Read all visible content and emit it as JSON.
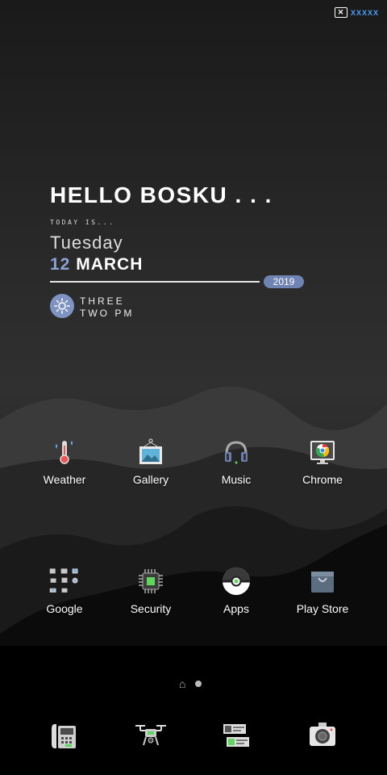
{
  "ad": {
    "label": "XXXXX",
    "close_glyph": "✕"
  },
  "widget": {
    "greeting": "HELLO BOSKU . . .",
    "today_is": "TODAY IS...",
    "weekday": "Tuesday",
    "day": "12",
    "month": "MARCH",
    "year": "2019",
    "time_line1": "THREE",
    "time_line2": "TWO PM",
    "weather_icon": "sun-icon"
  },
  "apps_row1": [
    {
      "label": "Weather",
      "icon": "thermometer-icon"
    },
    {
      "label": "Gallery",
      "icon": "picture-frame-icon"
    },
    {
      "label": "Music",
      "icon": "headphones-icon"
    },
    {
      "label": "Chrome",
      "icon": "chrome-monitor-icon"
    }
  ],
  "apps_row2": [
    {
      "label": "Google",
      "icon": "google-apps-grid-icon"
    },
    {
      "label": "Security",
      "icon": "chip-icon"
    },
    {
      "label": "Apps",
      "icon": "pokeball-icon"
    },
    {
      "label": "Play Store",
      "icon": "shopping-bag-icon"
    }
  ],
  "page_indicator": {
    "pages": 2,
    "current": 1,
    "home_glyph": "⌂"
  },
  "dock": [
    {
      "icon": "phone-icon"
    },
    {
      "icon": "drone-icon"
    },
    {
      "icon": "messages-icon"
    },
    {
      "icon": "camera-icon"
    }
  ],
  "colors": {
    "accent": "#7f93c2",
    "pill": "#6f84b2",
    "ad_text": "#4aa3ff"
  }
}
